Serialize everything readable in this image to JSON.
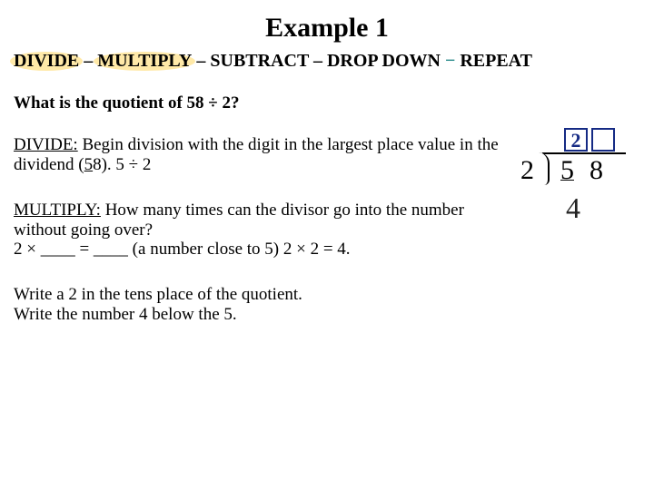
{
  "title": "Example 1",
  "steps": {
    "divide": "DIVIDE",
    "multiply": "MULTIPLY",
    "subtract": "SUBTRACT",
    "drop": "DROP DOWN",
    "repeat": "REPEAT",
    "sep_dark": " – ",
    "sep_teal": " − "
  },
  "question": "What is the quotient of 58 ÷ 2?",
  "p1": {
    "heading": "DIVIDE:",
    "t1": " Begin division with the digit in the largest place value in the dividend (",
    "five_u": "5",
    "t2": "8). 5 ÷ 2"
  },
  "p2": {
    "heading": "MULTIPLY:",
    "body": " How many times can the divisor go into the number without going over?",
    "line2": "2 × ____ = ____ (a number close to 5) 2 × 2 = 4."
  },
  "p3": {
    "l1": "Write a 2 in the tens place of the quotient.",
    "l2": "Write the number 4 below the 5."
  },
  "work": {
    "quotient_digit": "2",
    "divisor": "2",
    "dividend_tens": "5",
    "dividend_ones": "8",
    "product": "4"
  }
}
